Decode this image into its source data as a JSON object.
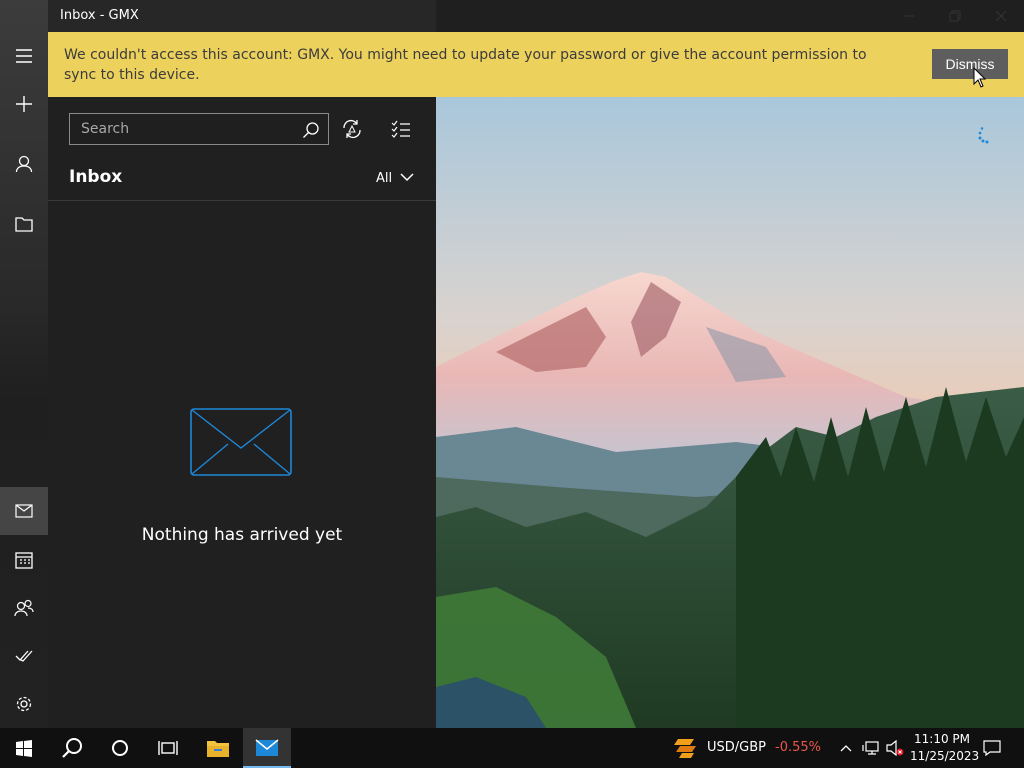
{
  "window": {
    "title": "Inbox - GMX"
  },
  "banner": {
    "message": "We couldn't access this account: GMX. You might need to update your password or give the account permission to sync to this device.",
    "dismiss_label": "Dismiss"
  },
  "search": {
    "placeholder": "Search"
  },
  "folder": {
    "title": "Inbox",
    "filter_label": "All"
  },
  "empty_state": {
    "message": "Nothing has arrived yet"
  },
  "taskbar": {
    "currency_pair": "USD/GBP",
    "currency_change": "-0.55%",
    "time": "11:10 PM",
    "date": "11/25/2023"
  },
  "colors": {
    "banner": "#ecd15c",
    "accent": "#1e88d8",
    "negative": "#e8584a"
  },
  "icons": [
    "hamburger-icon",
    "plus-icon",
    "person-icon",
    "folder-icon",
    "mail-icon",
    "calendar-icon",
    "people-icon",
    "checkmark-icon",
    "gear-icon",
    "search-icon",
    "sync-icon",
    "select-icon",
    "chevron-down-icon",
    "envelope-icon",
    "minimize-icon",
    "maximize-icon",
    "close-icon",
    "windows-icon",
    "cortana-icon",
    "task-view-icon",
    "file-explorer-icon",
    "mail-app-icon",
    "stocks-icon",
    "chevron-up-icon",
    "network-icon",
    "volume-muted-icon",
    "notification-icon"
  ]
}
